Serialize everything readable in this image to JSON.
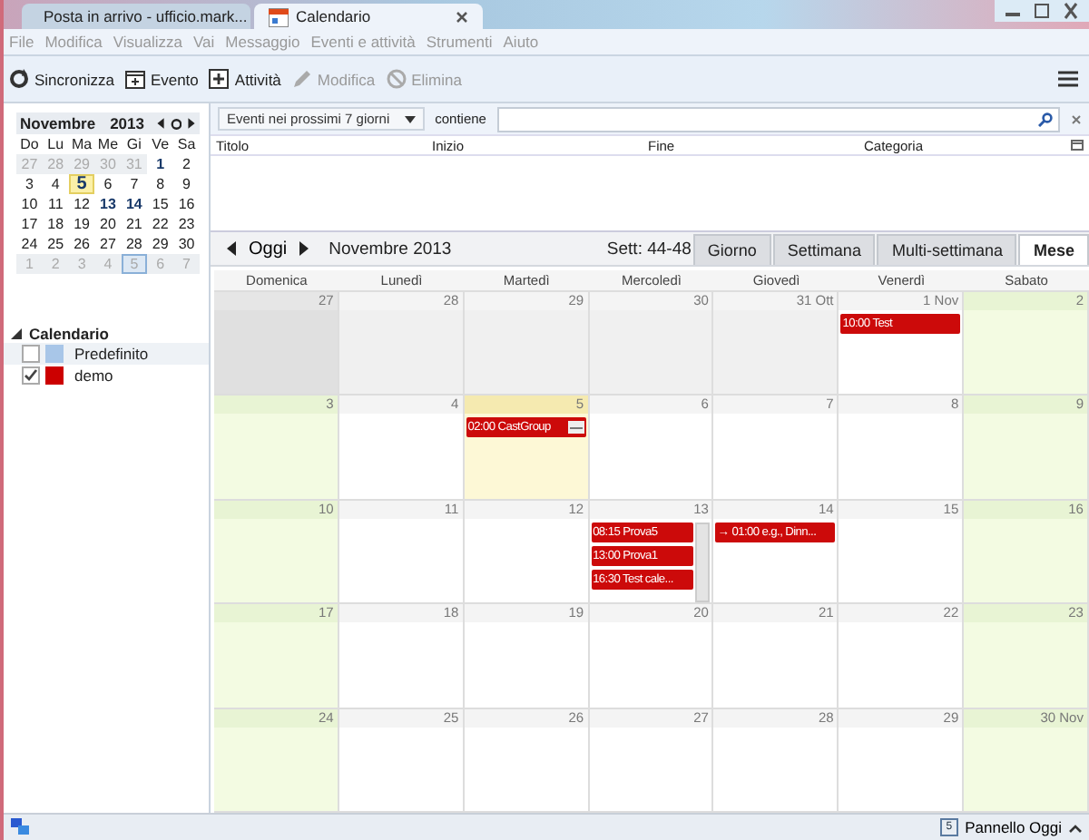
{
  "window": {
    "tabs": [
      {
        "label": "Posta in arrivo - ufficio.mark...",
        "kind": "mail",
        "selected": false
      },
      {
        "label": "Calendario",
        "kind": "calendar",
        "selected": true
      }
    ]
  },
  "menu": [
    "File",
    "Modifica",
    "Visualizza",
    "Vai",
    "Messaggio",
    "Eventi e attività",
    "Strumenti",
    "Aiuto"
  ],
  "toolbar": [
    {
      "label": "Sincronizza",
      "kind": "sync",
      "disabled": false
    },
    {
      "label": "Evento",
      "kind": "event",
      "disabled": false
    },
    {
      "label": "Attività",
      "kind": "task",
      "disabled": false
    },
    {
      "label": "Modifica",
      "kind": "edit",
      "disabled": true
    },
    {
      "label": "Elimina",
      "kind": "delete",
      "disabled": true
    }
  ],
  "minical": {
    "month": "Novembre",
    "year": "2013",
    "weekdays": [
      "Do",
      "Lu",
      "Ma",
      "Me",
      "Gi",
      "Ve",
      "Sa"
    ],
    "weeks": [
      [
        {
          "d": "27",
          "outside": true,
          "bold": false,
          "today": false,
          "selected": false
        },
        {
          "d": "28",
          "outside": true,
          "bold": false,
          "today": false,
          "selected": false
        },
        {
          "d": "29",
          "outside": true,
          "bold": false,
          "today": false,
          "selected": false
        },
        {
          "d": "30",
          "outside": true,
          "bold": false,
          "today": false,
          "selected": false
        },
        {
          "d": "31",
          "outside": true,
          "bold": false,
          "today": false,
          "selected": false
        },
        {
          "d": "1",
          "outside": false,
          "bold": true,
          "today": false,
          "selected": false
        },
        {
          "d": "2",
          "outside": false,
          "bold": false,
          "today": false,
          "selected": false
        }
      ],
      [
        {
          "d": "3",
          "outside": false,
          "bold": false,
          "today": false,
          "selected": false
        },
        {
          "d": "4",
          "outside": false,
          "bold": false,
          "today": false,
          "selected": false
        },
        {
          "d": "5",
          "outside": false,
          "bold": true,
          "today": true,
          "selected": false
        },
        {
          "d": "6",
          "outside": false,
          "bold": false,
          "today": false,
          "selected": false
        },
        {
          "d": "7",
          "outside": false,
          "bold": false,
          "today": false,
          "selected": false
        },
        {
          "d": "8",
          "outside": false,
          "bold": false,
          "today": false,
          "selected": false
        },
        {
          "d": "9",
          "outside": false,
          "bold": false,
          "today": false,
          "selected": false
        }
      ],
      [
        {
          "d": "10",
          "outside": false,
          "bold": false,
          "today": false,
          "selected": false
        },
        {
          "d": "11",
          "outside": false,
          "bold": false,
          "today": false,
          "selected": false
        },
        {
          "d": "12",
          "outside": false,
          "bold": false,
          "today": false,
          "selected": false
        },
        {
          "d": "13",
          "outside": false,
          "bold": true,
          "today": false,
          "selected": false
        },
        {
          "d": "14",
          "outside": false,
          "bold": true,
          "today": false,
          "selected": false
        },
        {
          "d": "15",
          "outside": false,
          "bold": false,
          "today": false,
          "selected": false
        },
        {
          "d": "16",
          "outside": false,
          "bold": false,
          "today": false,
          "selected": false
        }
      ],
      [
        {
          "d": "17",
          "outside": false,
          "bold": false,
          "today": false,
          "selected": false
        },
        {
          "d": "18",
          "outside": false,
          "bold": false,
          "today": false,
          "selected": false
        },
        {
          "d": "19",
          "outside": false,
          "bold": false,
          "today": false,
          "selected": false
        },
        {
          "d": "20",
          "outside": false,
          "bold": false,
          "today": false,
          "selected": false
        },
        {
          "d": "21",
          "outside": false,
          "bold": false,
          "today": false,
          "selected": false
        },
        {
          "d": "22",
          "outside": false,
          "bold": false,
          "today": false,
          "selected": false
        },
        {
          "d": "23",
          "outside": false,
          "bold": false,
          "today": false,
          "selected": false
        }
      ],
      [
        {
          "d": "24",
          "outside": false,
          "bold": false,
          "today": false,
          "selected": false
        },
        {
          "d": "25",
          "outside": false,
          "bold": false,
          "today": false,
          "selected": false
        },
        {
          "d": "26",
          "outside": false,
          "bold": false,
          "today": false,
          "selected": false
        },
        {
          "d": "27",
          "outside": false,
          "bold": false,
          "today": false,
          "selected": false
        },
        {
          "d": "28",
          "outside": false,
          "bold": false,
          "today": false,
          "selected": false
        },
        {
          "d": "29",
          "outside": false,
          "bold": false,
          "today": false,
          "selected": false
        },
        {
          "d": "30",
          "outside": false,
          "bold": false,
          "today": false,
          "selected": false
        }
      ],
      [
        {
          "d": "1",
          "outside": true,
          "bold": false,
          "today": false,
          "selected": false
        },
        {
          "d": "2",
          "outside": true,
          "bold": false,
          "today": false,
          "selected": false
        },
        {
          "d": "3",
          "outside": true,
          "bold": false,
          "today": false,
          "selected": false
        },
        {
          "d": "4",
          "outside": true,
          "bold": false,
          "today": false,
          "selected": false
        },
        {
          "d": "5",
          "outside": true,
          "bold": false,
          "today": false,
          "selected": true
        },
        {
          "d": "6",
          "outside": true,
          "bold": false,
          "today": false,
          "selected": false
        },
        {
          "d": "7",
          "outside": true,
          "bold": false,
          "today": false,
          "selected": false
        }
      ]
    ]
  },
  "calendars": {
    "title": "Calendario",
    "expanded": true,
    "items": [
      {
        "name": "Predefinito",
        "checked": false,
        "color": "#a8c6e8",
        "selected": true
      },
      {
        "name": "demo",
        "checked": true,
        "color": "#cc0000",
        "selected": false
      }
    ]
  },
  "filter": {
    "range": "Eventi nei prossimi 7 giorni",
    "label": "contiene"
  },
  "event_list": {
    "columns": [
      "Titolo",
      "Inizio",
      "Fine",
      "Categoria"
    ]
  },
  "nav": {
    "today": "Oggi",
    "title": "Novembre 2013",
    "weeks": "Sett: 44-48",
    "views": [
      {
        "label": "Giorno",
        "selected": false
      },
      {
        "label": "Settimana",
        "selected": false
      },
      {
        "label": "Multi-settimana",
        "selected": false
      },
      {
        "label": "Mese",
        "selected": true
      }
    ]
  },
  "month": {
    "weekdays": [
      "Domenica",
      "Lunedì",
      "Martedì",
      "Mercoledì",
      "Giovedì",
      "Venerdì",
      "Sabato"
    ],
    "weeks": [
      [
        {
          "d": "27",
          "outside": true,
          "today": false,
          "selected": true
        },
        {
          "d": "28",
          "outside": true,
          "today": false,
          "selected": false
        },
        {
          "d": "29",
          "outside": true,
          "today": false,
          "selected": false
        },
        {
          "d": "30",
          "outside": true,
          "today": false,
          "selected": false
        },
        {
          "d": "31 Ott",
          "outside": true,
          "today": false,
          "selected": false
        },
        {
          "d": "1 Nov",
          "outside": false,
          "today": false,
          "selected": false,
          "events": [
            {
              "text": "10:00 Test",
              "reminder": false
            }
          ]
        },
        {
          "d": "2",
          "outside": false,
          "today": false,
          "selected": false
        }
      ],
      [
        {
          "d": "3",
          "outside": false,
          "today": false,
          "selected": false
        },
        {
          "d": "4",
          "outside": false,
          "today": false,
          "selected": false
        },
        {
          "d": "5",
          "outside": false,
          "today": true,
          "selected": false,
          "events": [
            {
              "text": "02:00 CastGroup",
              "reminder": true
            }
          ]
        },
        {
          "d": "6",
          "outside": false,
          "today": false,
          "selected": false
        },
        {
          "d": "7",
          "outside": false,
          "today": false,
          "selected": false
        },
        {
          "d": "8",
          "outside": false,
          "today": false,
          "selected": false
        },
        {
          "d": "9",
          "outside": false,
          "today": false,
          "selected": false
        }
      ],
      [
        {
          "d": "10",
          "outside": false,
          "today": false,
          "selected": false
        },
        {
          "d": "11",
          "outside": false,
          "today": false,
          "selected": false
        },
        {
          "d": "12",
          "outside": false,
          "today": false,
          "selected": false
        },
        {
          "d": "13",
          "outside": false,
          "today": false,
          "selected": false,
          "events": [
            {
              "text": "08:15 Prova5",
              "reminder": false
            },
            {
              "text": "13:00 Prova1",
              "reminder": false
            },
            {
              "text": "16:30 Test cale...",
              "reminder": false
            }
          ]
        },
        {
          "d": "14",
          "outside": false,
          "today": false,
          "selected": false,
          "events": [
            {
              "text": "→ 01:00 e.g., Dinn...",
              "reminder": false
            }
          ]
        },
        {
          "d": "15",
          "outside": false,
          "today": false,
          "selected": false
        },
        {
          "d": "16",
          "outside": false,
          "today": false,
          "selected": false
        }
      ],
      [
        {
          "d": "17",
          "outside": false,
          "today": false,
          "selected": false
        },
        {
          "d": "18",
          "outside": false,
          "today": false,
          "selected": false
        },
        {
          "d": "19",
          "outside": false,
          "today": false,
          "selected": false
        },
        {
          "d": "20",
          "outside": false,
          "today": false,
          "selected": false
        },
        {
          "d": "21",
          "outside": false,
          "today": false,
          "selected": false
        },
        {
          "d": "22",
          "outside": false,
          "today": false,
          "selected": false
        },
        {
          "d": "23",
          "outside": false,
          "today": false,
          "selected": false
        }
      ],
      [
        {
          "d": "24",
          "outside": false,
          "today": false,
          "selected": false
        },
        {
          "d": "25",
          "outside": false,
          "today": false,
          "selected": false
        },
        {
          "d": "26",
          "outside": false,
          "today": false,
          "selected": false
        },
        {
          "d": "27",
          "outside": false,
          "today": false,
          "selected": false
        },
        {
          "d": "28",
          "outside": false,
          "today": false,
          "selected": false
        },
        {
          "d": "29",
          "outside": false,
          "today": false,
          "selected": false
        },
        {
          "d": "30 Nov",
          "outside": false,
          "today": false,
          "selected": false
        }
      ]
    ]
  },
  "status_bar": {
    "today_pane": "Pannello Oggi",
    "today_icon_day": "5"
  }
}
